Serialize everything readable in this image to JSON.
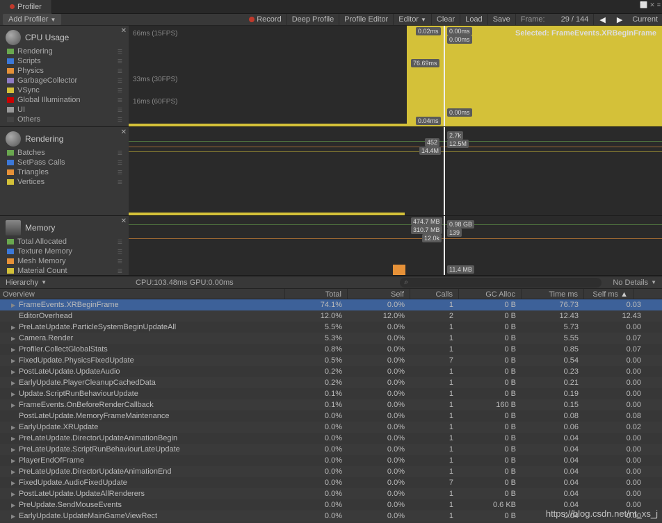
{
  "window": {
    "tab": "Profiler"
  },
  "toolbar": {
    "add_profiler": "Add Profiler",
    "record": "Record",
    "deep_profile": "Deep Profile",
    "profile_editor": "Profile Editor",
    "editor": "Editor",
    "clear": "Clear",
    "load": "Load",
    "save": "Save",
    "frame_label": "Frame:",
    "frame_value": "29 / 144",
    "current": "Current"
  },
  "cpu_panel": {
    "title": "CPU Usage",
    "legend": [
      {
        "label": "Rendering",
        "color": "#6aa84f"
      },
      {
        "label": "Scripts",
        "color": "#3c78d8"
      },
      {
        "label": "Physics",
        "color": "#e69138"
      },
      {
        "label": "GarbageCollector",
        "color": "#8e7cc3"
      },
      {
        "label": "VSync",
        "color": "#d4c139"
      },
      {
        "label": "Global Illumination",
        "color": "#cc0000"
      },
      {
        "label": "UI",
        "color": "#999999"
      },
      {
        "label": "Others",
        "color": "#444444"
      }
    ],
    "lines": [
      {
        "label": "66ms (15FPS)"
      },
      {
        "label": "33ms (30FPS)"
      },
      {
        "label": "16ms (60FPS)"
      }
    ],
    "data_labels": [
      "0.02ms",
      "0.00ms",
      "0.00ms",
      "76.69ms",
      "0.04ms",
      "0.00ms"
    ],
    "selected": "Selected: FrameEvents.XRBeginFrame"
  },
  "rendering_panel": {
    "title": "Rendering",
    "legend": [
      {
        "label": "Batches",
        "color": "#6aa84f"
      },
      {
        "label": "SetPass Calls",
        "color": "#3c78d8"
      },
      {
        "label": "Triangles",
        "color": "#e69138"
      },
      {
        "label": "Vertices",
        "color": "#d4c139"
      }
    ],
    "data_labels": [
      "452",
      "14.4M",
      "2.7k",
      "12.5M"
    ]
  },
  "memory_panel": {
    "title": "Memory",
    "legend": [
      {
        "label": "Total Allocated",
        "color": "#6aa84f"
      },
      {
        "label": "Texture Memory",
        "color": "#3c78d8"
      },
      {
        "label": "Mesh Memory",
        "color": "#e69138"
      },
      {
        "label": "Material Count",
        "color": "#d4c139"
      }
    ],
    "data_labels": [
      "474.7 MB",
      "310.7 MB",
      "12.0k",
      "0.98 GB",
      "139",
      "11.4 MB"
    ]
  },
  "hierarchy": {
    "mode": "Hierarchy",
    "cpu_gpu": "CPU:103.48ms   GPU:0.00ms",
    "details": "No Details"
  },
  "table": {
    "headers": {
      "overview": "Overview",
      "total": "Total",
      "self": "Self",
      "calls": "Calls",
      "gc_alloc": "GC Alloc",
      "time_ms": "Time ms",
      "self_ms": "Self ms"
    },
    "rows": [
      {
        "name": "FrameEvents.XRBeginFrame",
        "total": "74.1%",
        "self": "0.0%",
        "calls": "1",
        "gc": "0 B",
        "time": "76.73",
        "selfms": "0.03",
        "expand": true,
        "selected": true
      },
      {
        "name": "EditorOverhead",
        "total": "12.0%",
        "self": "12.0%",
        "calls": "2",
        "gc": "0 B",
        "time": "12.43",
        "selfms": "12.43",
        "expand": false
      },
      {
        "name": "PreLateUpdate.ParticleSystemBeginUpdateAll",
        "total": "5.5%",
        "self": "0.0%",
        "calls": "1",
        "gc": "0 B",
        "time": "5.73",
        "selfms": "0.00",
        "expand": true
      },
      {
        "name": "Camera.Render",
        "total": "5.3%",
        "self": "0.0%",
        "calls": "1",
        "gc": "0 B",
        "time": "5.55",
        "selfms": "0.07",
        "expand": true
      },
      {
        "name": "Profiler.CollectGlobalStats",
        "total": "0.8%",
        "self": "0.0%",
        "calls": "1",
        "gc": "0 B",
        "time": "0.85",
        "selfms": "0.07",
        "expand": true
      },
      {
        "name": "FixedUpdate.PhysicsFixedUpdate",
        "total": "0.5%",
        "self": "0.0%",
        "calls": "7",
        "gc": "0 B",
        "time": "0.54",
        "selfms": "0.00",
        "expand": true
      },
      {
        "name": "PostLateUpdate.UpdateAudio",
        "total": "0.2%",
        "self": "0.0%",
        "calls": "1",
        "gc": "0 B",
        "time": "0.23",
        "selfms": "0.00",
        "expand": true
      },
      {
        "name": "EarlyUpdate.PlayerCleanupCachedData",
        "total": "0.2%",
        "self": "0.0%",
        "calls": "1",
        "gc": "0 B",
        "time": "0.21",
        "selfms": "0.00",
        "expand": true
      },
      {
        "name": "Update.ScriptRunBehaviourUpdate",
        "total": "0.1%",
        "self": "0.0%",
        "calls": "1",
        "gc": "0 B",
        "time": "0.19",
        "selfms": "0.00",
        "expand": true
      },
      {
        "name": "FrameEvents.OnBeforeRenderCallback",
        "total": "0.1%",
        "self": "0.0%",
        "calls": "1",
        "gc": "160 B",
        "time": "0.15",
        "selfms": "0.00",
        "expand": true
      },
      {
        "name": "PostLateUpdate.MemoryFrameMaintenance",
        "total": "0.0%",
        "self": "0.0%",
        "calls": "1",
        "gc": "0 B",
        "time": "0.08",
        "selfms": "0.08",
        "expand": false
      },
      {
        "name": "EarlyUpdate.XRUpdate",
        "total": "0.0%",
        "self": "0.0%",
        "calls": "1",
        "gc": "0 B",
        "time": "0.06",
        "selfms": "0.02",
        "expand": true
      },
      {
        "name": "PreLateUpdate.DirectorUpdateAnimationBegin",
        "total": "0.0%",
        "self": "0.0%",
        "calls": "1",
        "gc": "0 B",
        "time": "0.04",
        "selfms": "0.00",
        "expand": true
      },
      {
        "name": "PreLateUpdate.ScriptRunBehaviourLateUpdate",
        "total": "0.0%",
        "self": "0.0%",
        "calls": "1",
        "gc": "0 B",
        "time": "0.04",
        "selfms": "0.00",
        "expand": true
      },
      {
        "name": "PlayerEndOfFrame",
        "total": "0.0%",
        "self": "0.0%",
        "calls": "1",
        "gc": "0 B",
        "time": "0.04",
        "selfms": "0.00",
        "expand": true
      },
      {
        "name": "PreLateUpdate.DirectorUpdateAnimationEnd",
        "total": "0.0%",
        "self": "0.0%",
        "calls": "1",
        "gc": "0 B",
        "time": "0.04",
        "selfms": "0.00",
        "expand": true
      },
      {
        "name": "FixedUpdate.AudioFixedUpdate",
        "total": "0.0%",
        "self": "0.0%",
        "calls": "7",
        "gc": "0 B",
        "time": "0.04",
        "selfms": "0.00",
        "expand": true
      },
      {
        "name": "PostLateUpdate.UpdateAllRenderers",
        "total": "0.0%",
        "self": "0.0%",
        "calls": "1",
        "gc": "0 B",
        "time": "0.04",
        "selfms": "0.00",
        "expand": true
      },
      {
        "name": "PreUpdate.SendMouseEvents",
        "total": "0.0%",
        "self": "0.0%",
        "calls": "1",
        "gc": "0.6 KB",
        "time": "0.04",
        "selfms": "0.00",
        "expand": true
      },
      {
        "name": "EarlyUpdate.UpdateMainGameViewRect",
        "total": "0.0%",
        "self": "0.0%",
        "calls": "1",
        "gc": "0 B",
        "time": "0.04",
        "selfms": "0.00",
        "expand": true
      }
    ]
  },
  "watermark": "https://blog.csdn.net/nt_xs_j"
}
